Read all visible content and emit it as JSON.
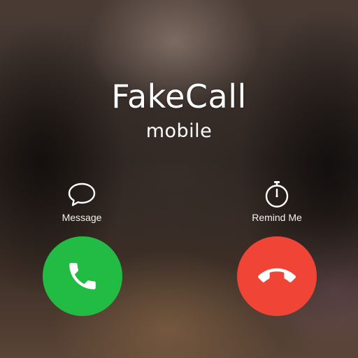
{
  "caller": {
    "name": "FakeCall",
    "label": "mobile"
  },
  "actions": {
    "message": {
      "label": "Message",
      "icon": "message-bubble-icon"
    },
    "remind": {
      "label": "Remind Me",
      "icon": "stopwatch-icon"
    }
  },
  "buttons": {
    "accept": {
      "icon": "phone-icon",
      "color": "#22bc45"
    },
    "decline": {
      "icon": "hang-up-icon",
      "color": "#f04437"
    }
  }
}
